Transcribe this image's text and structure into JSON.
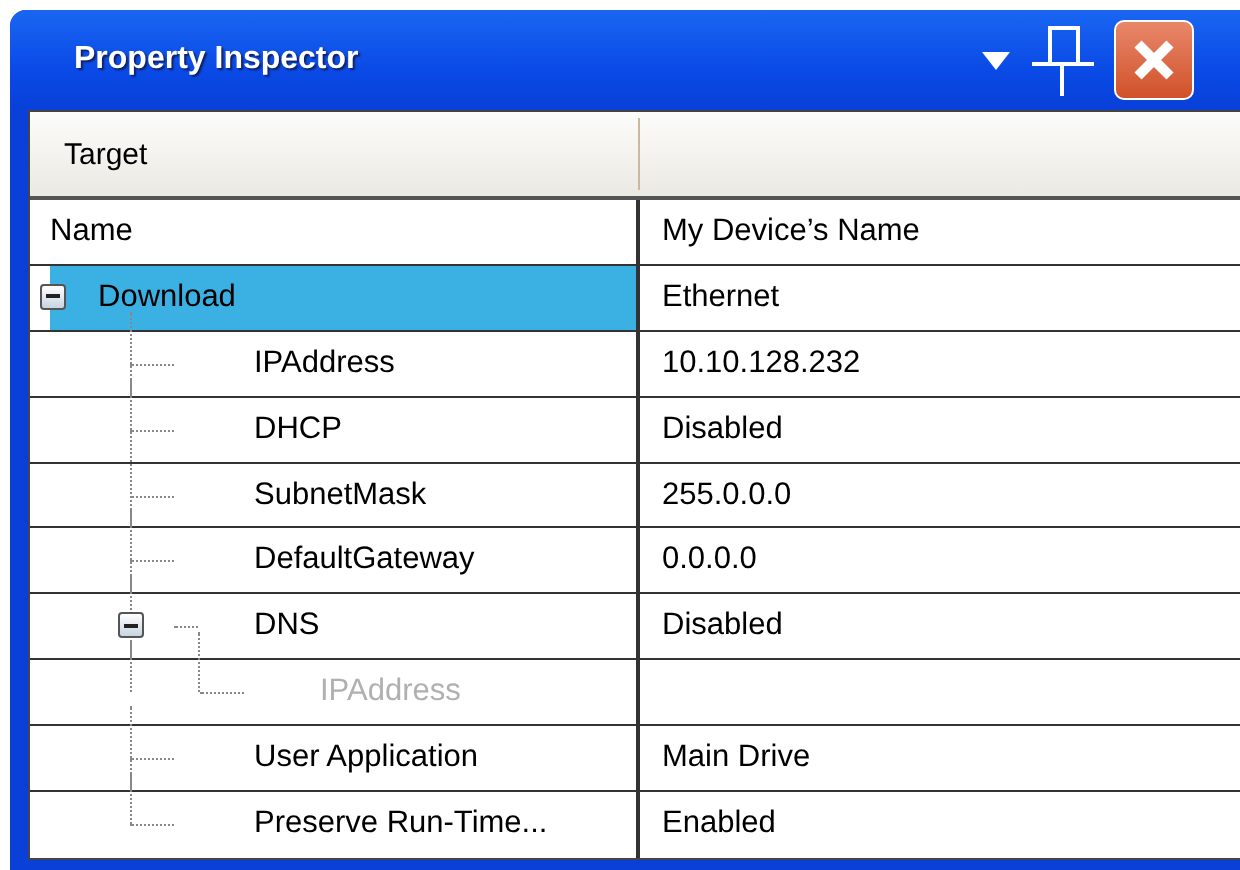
{
  "window": {
    "title": "Property Inspector"
  },
  "toolbar": {
    "label": "Target"
  },
  "table": {
    "columns": [
      "Name",
      "My Device’s Name"
    ],
    "rows": [
      {
        "name": "Download",
        "value": "Ethernet",
        "selected": true,
        "expanded": true,
        "children": [
          {
            "name": "IPAddress",
            "value": "10.10.128.232",
            "selected": false
          },
          {
            "name": "DHCP",
            "value": "Disabled",
            "selected": false
          },
          {
            "name": "SubnetMask",
            "value": "255.0.0.0",
            "selected": false
          },
          {
            "name": "DefaultGateway",
            "value": "0.0.0.0",
            "selected": false
          },
          {
            "name": "DNS",
            "value": "Disabled",
            "selected": false,
            "expanded": true,
            "children": [
              {
                "name": "IPAddress",
                "selected": false,
                "disabled": true
              }
            ]
          },
          {
            "name": "User Application",
            "value": "Main Drive",
            "selected": false
          },
          {
            "name": "Preserve Run-Time...",
            "value": "Enabled",
            "selected": false
          }
        ]
      }
    ]
  }
}
